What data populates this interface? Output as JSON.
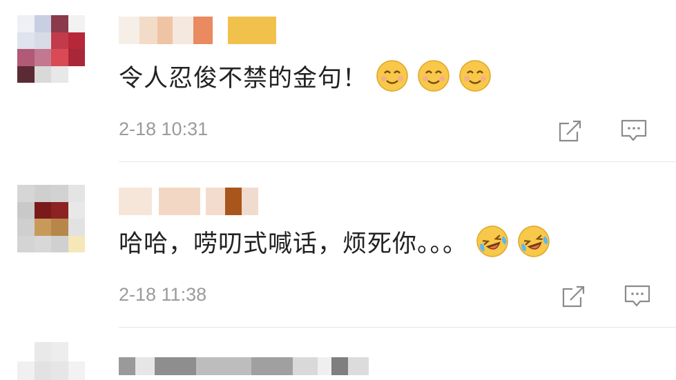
{
  "comments": [
    {
      "text": "令人忍俊不禁的金句！",
      "emoji_count": 3,
      "emoji_icon": "smile-icon",
      "time": "2-18 10:31"
    },
    {
      "text": "哈哈，唠叨式喊话，烦死你。。。",
      "emoji_count": 2,
      "emoji_icon": "laugh-cry-icon",
      "time": "2-18 11:38"
    }
  ],
  "actions": {
    "share_icon": "share-icon",
    "reply_icon": "reply-icon"
  },
  "colors": {
    "text": "#222222",
    "time": "#9a9a9a",
    "icon": "#8a8a8a",
    "divider": "#e6e6e6",
    "emoji_yellow": "#f7c84a"
  }
}
